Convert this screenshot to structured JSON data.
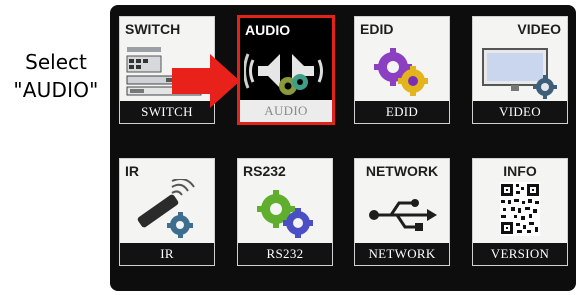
{
  "annotation": {
    "line1": "Select",
    "line2": "\"AUDIO\""
  },
  "menu": {
    "tiles": [
      {
        "header": "SWITCH",
        "label": "SWITCH",
        "icon": "switch-icon"
      },
      {
        "header": "AUDIO",
        "label": "AUDIO",
        "icon": "audio-icon",
        "selected": true
      },
      {
        "header": "EDID",
        "label": "EDID",
        "icon": "edid-gears-icon"
      },
      {
        "header": "VIDEO",
        "label": "VIDEO",
        "icon": "video-monitor-icon"
      },
      {
        "header": "IR",
        "label": "IR",
        "icon": "ir-remote-icon"
      },
      {
        "header": "RS232",
        "label": "RS232",
        "icon": "rs232-gears-icon"
      },
      {
        "header": "NETWORK",
        "label": "NETWORK",
        "icon": "usb-network-icon"
      },
      {
        "header": "INFO",
        "label": "VERSION",
        "icon": "qr-code-icon"
      }
    ]
  },
  "colors": {
    "highlight_border": "#e0241c",
    "pointer_arrow": "#e8221a",
    "screen_bg": "#0d0d0d",
    "tile_bg": "#f4f5f3"
  }
}
